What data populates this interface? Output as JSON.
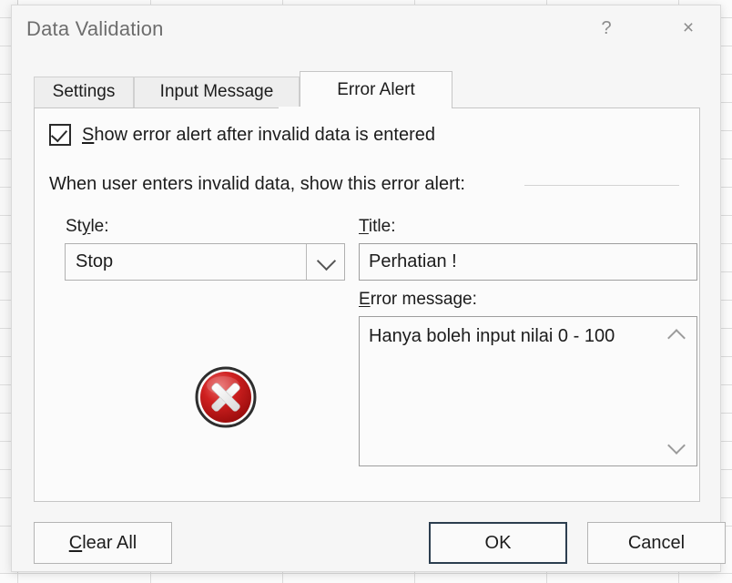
{
  "window": {
    "title": "Data Validation",
    "help_label": "?",
    "close_label": "×",
    "help_icon": "question-mark-icon",
    "close_icon": "close-icon"
  },
  "tabs": [
    {
      "id": "settings",
      "label": "Settings",
      "active": false
    },
    {
      "id": "input-message",
      "label": "Input Message",
      "active": false
    },
    {
      "id": "error-alert",
      "label": "Error Alert",
      "active": true
    }
  ],
  "panel": {
    "show_error_alert": {
      "checked": true,
      "accel": "S",
      "rest": "how error alert after invalid data is entered"
    },
    "instruction": "When user enters invalid data, show this error alert:",
    "style": {
      "accel": "St",
      "label_accel_char": "y",
      "label_tail": "le:",
      "label_full": "Style:",
      "value": "Stop",
      "dropdown_icon": "chevron-down-icon"
    },
    "title_field": {
      "accel": "T",
      "label_tail": "itle:",
      "label_full": "Title:",
      "value": "Perhatian !"
    },
    "error_message": {
      "accel": "E",
      "label_tail": "rror message:",
      "label_full": "Error message:",
      "value": "Hanya boleh input nilai 0 - 100",
      "scroll_up_icon": "chevron-up-icon",
      "scroll_down_icon": "chevron-down-icon"
    },
    "style_icon": {
      "name": "error-stop-icon",
      "ring_color": "#2b2b2b",
      "fill_color": "#c41a1a",
      "glyph_color": "#ffffff"
    }
  },
  "footer": {
    "clear_all": {
      "accel": "C",
      "tail": "lear All",
      "label": "Clear All"
    },
    "ok": {
      "label": "OK",
      "default": true
    },
    "cancel": {
      "label": "Cancel",
      "default": false
    }
  },
  "colors": {
    "dialog_bg": "#f6f6f6",
    "panel_bg": "#fbfbfb",
    "title_text": "#6d6d6d",
    "body_text": "#1c1c1c",
    "default_button_border": "#2c3e4f",
    "grid_line": "#dcdcdc"
  }
}
